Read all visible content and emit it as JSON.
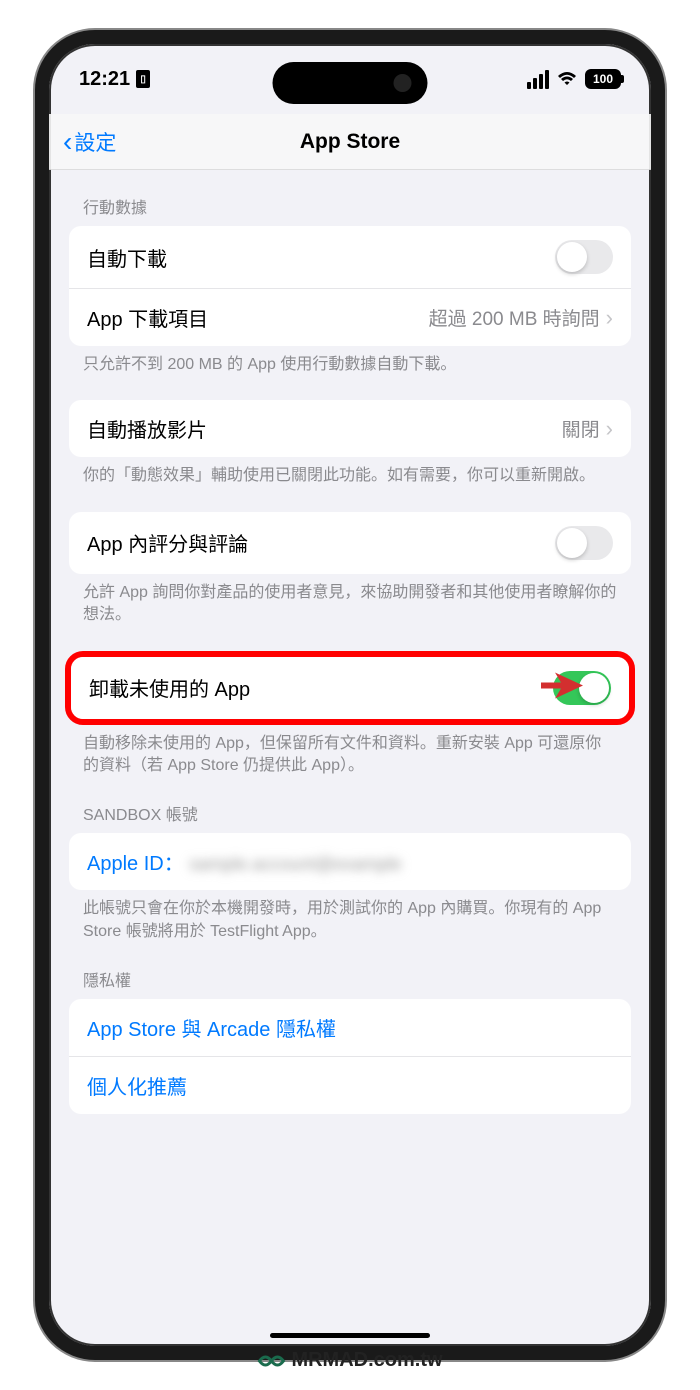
{
  "statusBar": {
    "time": "12:21",
    "batteryLevel": "100"
  },
  "nav": {
    "back": "設定",
    "title": "App Store"
  },
  "sections": {
    "cellularHeader": "行動數據",
    "autoDownload": "自動下載",
    "appDownloads": {
      "label": "App 下載項目",
      "value": "超過 200 MB 時詢問"
    },
    "cellularFooter": "只允許不到 200 MB 的 App 使用行動數據自動下載。",
    "autoPlay": {
      "label": "自動播放影片",
      "value": "關閉"
    },
    "autoPlayFooter": "你的「動態效果」輔助使用已關閉此功能。如有需要，你可以重新開啟。",
    "ratings": "App 內評分與評論",
    "ratingsFooter": "允許 App 詢問你對產品的使用者意見，來協助開發者和其他使用者瞭解你的想法。",
    "offload": "卸載未使用的 App",
    "offloadFooter": "自動移除未使用的 App，但保留所有文件和資料。重新安裝 App 可還原你的資料（若 App Store 仍提供此 App）。",
    "sandboxHeader": "SANDBOX 帳號",
    "appleIdLabel": "Apple ID：",
    "appleIdValue": "sample.account@example",
    "sandboxFooter": "此帳號只會在你於本機開發時，用於測試你的 App 內購買。你現有的 App Store 帳號將用於 TestFlight App。",
    "privacyHeader": "隱私權",
    "privacyLink1": "App Store 與 Arcade 隱私權",
    "privacyLink2": "個人化推薦"
  },
  "watermark": "MRMAD.com.tw"
}
